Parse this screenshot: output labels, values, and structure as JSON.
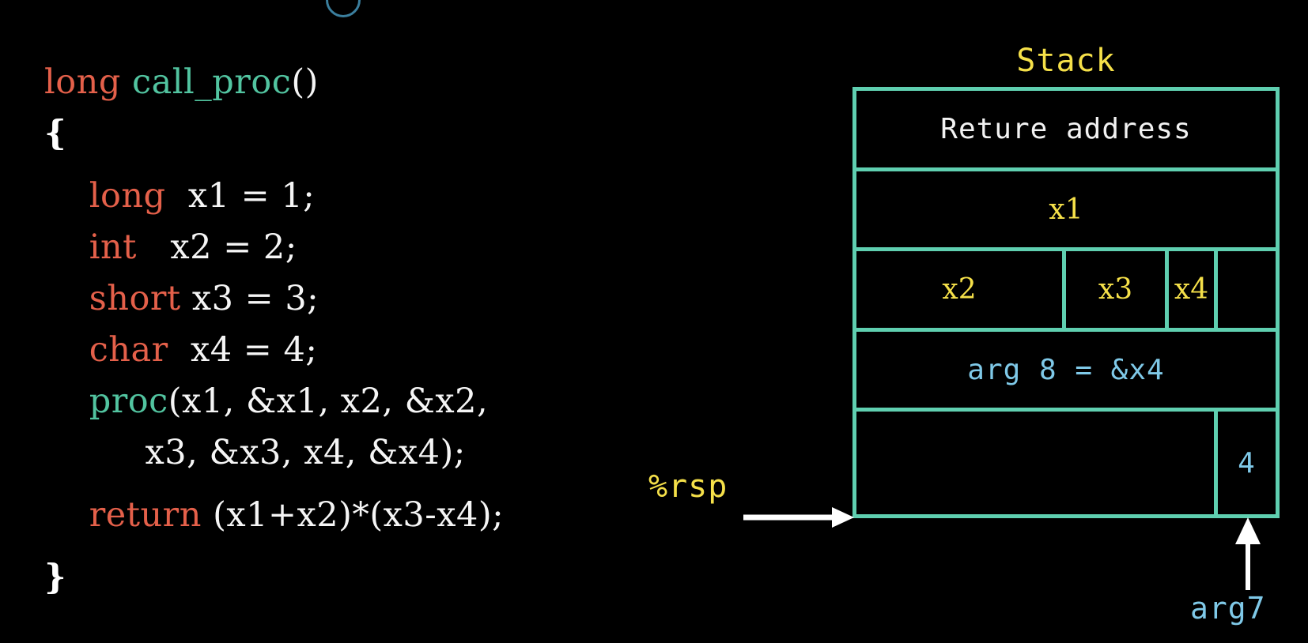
{
  "background_color": "#000000",
  "palette": {
    "keyword": "#e4604a",
    "function": "#52c4a0",
    "plain_text": "#f2f2f2",
    "accent_yellow": "#f5e049",
    "accent_blue": "#7fc9e8",
    "border_teal": "#5fcfb0",
    "arrow_white": "#ffffff"
  },
  "code": {
    "lines": [
      {
        "indent": 0,
        "tokens": [
          {
            "text": "long",
            "kind": "keyword"
          },
          {
            "text": " ",
            "kind": "plain"
          },
          {
            "text": "call_proc",
            "kind": "function"
          },
          {
            "text": "()",
            "kind": "plain"
          }
        ]
      },
      {
        "indent": 0,
        "tokens": [
          {
            "text": "{",
            "kind": "brace"
          }
        ]
      },
      {
        "indent": 1,
        "gap": true,
        "tokens": [
          {
            "text": "long",
            "kind": "keyword"
          },
          {
            "text": "  x1 = 1;",
            "kind": "plain"
          }
        ]
      },
      {
        "indent": 1,
        "tokens": [
          {
            "text": "int",
            "kind": "keyword"
          },
          {
            "text": "   x2 = 2;",
            "kind": "plain"
          }
        ]
      },
      {
        "indent": 1,
        "tokens": [
          {
            "text": "short",
            "kind": "keyword"
          },
          {
            "text": " x3 = 3;",
            "kind": "plain"
          }
        ]
      },
      {
        "indent": 1,
        "tokens": [
          {
            "text": "char",
            "kind": "keyword"
          },
          {
            "text": "  x4 = 4;",
            "kind": "plain"
          }
        ]
      },
      {
        "indent": 1,
        "tokens": [
          {
            "text": "proc",
            "kind": "function"
          },
          {
            "text": "(x1, &x1, x2, &x2,",
            "kind": "plain"
          }
        ]
      },
      {
        "indent": 1,
        "tokens": [
          {
            "text": "     x3, &x3, x4, &x4);",
            "kind": "plain"
          }
        ]
      },
      {
        "indent": 1,
        "gap": true,
        "tokens": [
          {
            "text": "return",
            "kind": "keyword"
          },
          {
            "text": " (x1+x2)*(x3-x4);",
            "kind": "plain"
          }
        ]
      },
      {
        "indent": 0,
        "gap": true,
        "tokens": [
          {
            "text": "}",
            "kind": "brace"
          }
        ]
      }
    ]
  },
  "stack": {
    "title": "Stack",
    "rows": [
      {
        "name": "return-address-row",
        "cells": [
          {
            "label": "Reture address",
            "color": "white"
          }
        ]
      },
      {
        "name": "x1-row",
        "cells": [
          {
            "label": "x1",
            "color": "yellow"
          }
        ]
      },
      {
        "name": "x2-x3-x4-row",
        "cells": [
          {
            "label": "x2",
            "color": "yellow"
          },
          {
            "label": "x3",
            "color": "yellow"
          },
          {
            "label": "x4",
            "color": "yellow"
          },
          {
            "label": "",
            "color": "yellow"
          }
        ]
      },
      {
        "name": "arg8-row",
        "cells": [
          {
            "label": "arg 8 = &x4",
            "color": "blue"
          }
        ]
      },
      {
        "name": "arg7-row",
        "cells": [
          {
            "label": "",
            "color": "blue"
          },
          {
            "label": "4",
            "color": "blue"
          }
        ]
      }
    ]
  },
  "pointers": {
    "rsp_label": "%rsp",
    "arg7_label": "arg7"
  }
}
